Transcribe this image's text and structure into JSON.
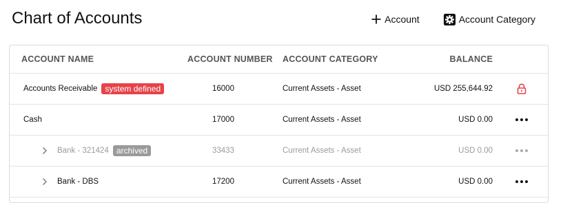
{
  "page": {
    "title": "Chart of Accounts"
  },
  "actions": {
    "add_account": {
      "label": "Account",
      "icon": "plus-icon"
    },
    "add_category": {
      "label": "Account Category",
      "icon": "gear-icon"
    }
  },
  "table": {
    "columns": {
      "name": "ACCOUNT NAME",
      "number": "ACCOUNT NUMBER",
      "category": "ACCOUNT CATEGORY",
      "balance": "BALANCE"
    },
    "rows": [
      {
        "name": "Accounts Receivable",
        "badge": "system defined",
        "badge_color": "#e5434a",
        "number": "16000",
        "category": "Current Assets - Asset",
        "balance": "USD 255,644.92",
        "action_icon": "lock-icon",
        "archived": false,
        "child": false
      },
      {
        "name": "Cash",
        "badge": "",
        "number": "17000",
        "category": "Current Assets - Asset",
        "balance": "USD 0.00",
        "action_icon": "more-icon",
        "archived": false,
        "child": false
      },
      {
        "name": "Bank - 321424",
        "badge": "archived",
        "badge_color": "#9a9a9a",
        "number": "33433",
        "category": "Current Assets - Asset",
        "balance": "USD 0.00",
        "action_icon": "more-icon",
        "archived": true,
        "child": true
      },
      {
        "name": "Bank - DBS",
        "badge": "",
        "number": "17200",
        "category": "Current Assets - Asset",
        "balance": "USD 0.00",
        "action_icon": "more-icon",
        "archived": false,
        "child": true
      }
    ]
  },
  "colors": {
    "system_badge": "#e5434a",
    "archived_badge": "#9a9a9a",
    "lock": "#e5434a"
  }
}
